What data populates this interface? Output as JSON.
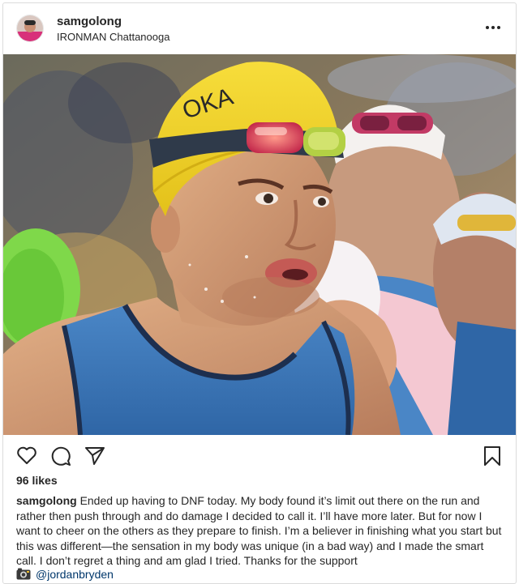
{
  "post": {
    "username": "samgolong",
    "location": "IRONMAN Chattanooga",
    "more_icon": "more-horizontal-icon",
    "actions": {
      "like_icon": "heart-icon",
      "comment_icon": "comment-icon",
      "share_icon": "paper-plane-icon",
      "save_icon": "bookmark-icon"
    },
    "likes": "96 likes",
    "caption_user": "samgolong",
    "caption_text": "Ended up having to DNF today. My body found it’s limit out there on the run and rather then push through and do damage I decided to call it. I’ll have more later. But for now I want to cheer on the others as they prepare to finish. I’m a believer in finishing what you start but this was different—the sensation in my body was unique (in a bad way) and I made the smart call. I don’t regret a thing and am glad I tried. Thanks for the support",
    "credit_icon": "camera-icon",
    "credit": "@jordanbryden",
    "cap_lettering": "OKA"
  },
  "colors": {
    "link": "#00376b",
    "text": "#262626",
    "border": "#dbdbdb",
    "cap": "#f2cf1e",
    "singlet": "#3d78b8"
  }
}
